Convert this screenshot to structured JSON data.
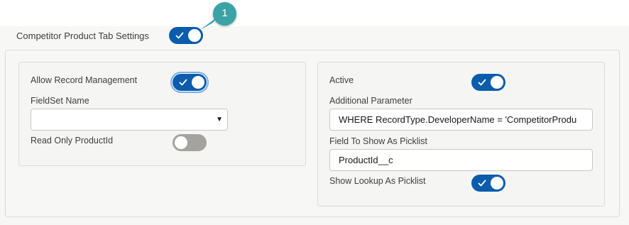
{
  "header": {
    "tab_settings_label": "Competitor Product Tab Settings",
    "tab_settings_on": true
  },
  "callout": {
    "number": "1"
  },
  "left_card": {
    "allow_record_management_label": "Allow Record Management",
    "allow_record_management_on": true,
    "fieldset_name_label": "FieldSet Name",
    "fieldset_name_value": "",
    "fieldset_arrow": "▼",
    "read_only_product_id_label": "Read Only ProductId",
    "read_only_product_id_on": false
  },
  "right_card": {
    "active_label": "Active",
    "active_on": true,
    "additional_parameter_label": "Additional Parameter",
    "additional_parameter_value": "WHERE RecordType.DeveloperName = 'CompetitorProdu",
    "field_to_show_label": "Field To Show As Picklist",
    "field_to_show_value": "ProductId__c",
    "show_lookup_label": "Show Lookup As Picklist",
    "show_lookup_on": true
  },
  "colors": {
    "toggle_on": "#0b5cab",
    "toggle_off": "#a5a3a0",
    "callout": "#3aa3a6"
  },
  "icons": {
    "toggle_check": "check-icon",
    "callout_pointer": "callout-pointer"
  }
}
